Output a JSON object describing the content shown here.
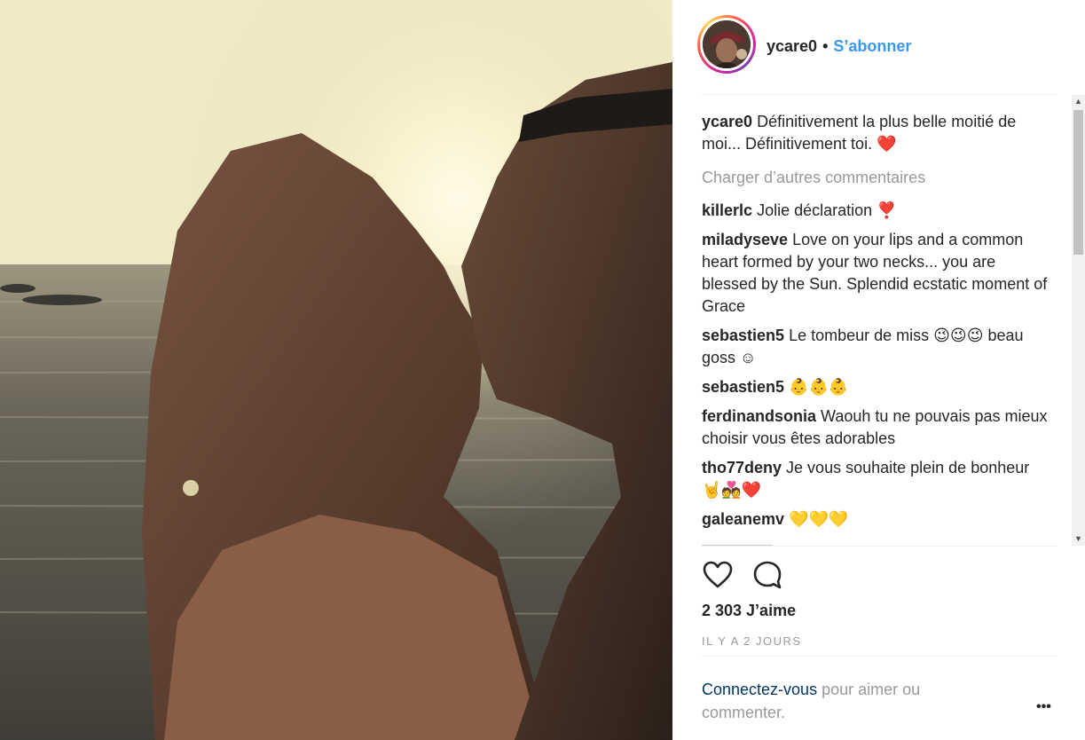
{
  "post": {
    "username": "ycare0",
    "separator": "•",
    "follow_label": "S’abonner",
    "caption": {
      "user": "ycare0",
      "text": "Définitivement la plus belle moitié de moi... Définitivement toi.",
      "emoji": "❤️"
    },
    "load_more_label": "Charger d’autres commentaires",
    "comments": [
      {
        "user": "killerlc",
        "text": "Jolie déclaration",
        "emoji": "❣️"
      },
      {
        "user": "miladyseve",
        "text": "Love on your lips and a common heart formed by your two necks... you are blessed by the Sun. Splendid ecstatic moment of Grace",
        "emoji": ""
      },
      {
        "user": "sebastien5",
        "text": "Le tombeur de miss",
        "emoji": "😉😉😉",
        "text2": "beau goss ☺"
      },
      {
        "user": "sebastien5",
        "text": "",
        "emoji": "👶👶👶"
      },
      {
        "user": "ferdinandsonia",
        "text": "Waouh tu ne pouvais pas mieux choisir vous êtes adorables",
        "emoji": ""
      },
      {
        "user": "tho77deny",
        "text": "Je vous souhaite plein de bonheur",
        "emoji": "🤘💑❤️"
      },
      {
        "user": "galeanemv",
        "text": "",
        "emoji": "💛💛💛"
      }
    ],
    "likes_label": "2 303 J’aime",
    "time_label": "IL Y A 2 JOURS",
    "login_link": "Connectez-vous",
    "login_text": " pour aimer ou commenter.",
    "more_label": "•••"
  },
  "icons": {
    "like": "heart-outline-icon",
    "comment": "comment-bubble-icon"
  },
  "colors": {
    "link_blue": "#3897f0",
    "login_blue": "#003569",
    "muted": "#999999"
  }
}
